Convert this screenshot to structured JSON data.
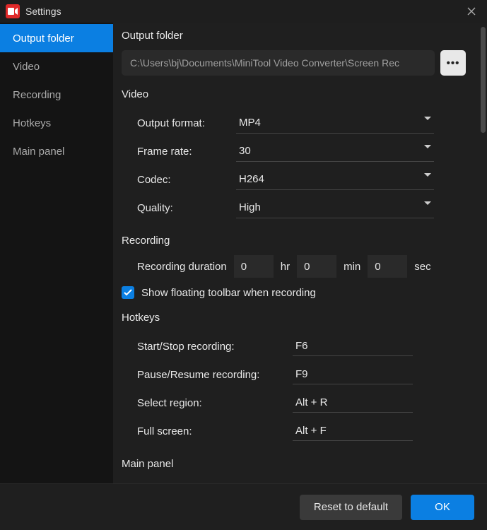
{
  "window": {
    "title": "Settings",
    "icon_name": "camera-icon"
  },
  "sidebar": {
    "items": [
      {
        "label": "Output folder",
        "active": true
      },
      {
        "label": "Video",
        "active": false
      },
      {
        "label": "Recording",
        "active": false
      },
      {
        "label": "Hotkeys",
        "active": false
      },
      {
        "label": "Main panel",
        "active": false
      }
    ]
  },
  "sections": {
    "output_folder": {
      "title": "Output folder",
      "path": "C:\\Users\\bj\\Documents\\MiniTool Video Converter\\Screen Rec",
      "browse_label": "•••"
    },
    "video": {
      "title": "Video",
      "rows": {
        "output_format": {
          "label": "Output format:",
          "value": "MP4"
        },
        "frame_rate": {
          "label": "Frame rate:",
          "value": "30"
        },
        "codec": {
          "label": "Codec:",
          "value": "H264"
        },
        "quality": {
          "label": "Quality:",
          "value": "High"
        }
      }
    },
    "recording": {
      "title": "Recording",
      "duration_label": "Recording duration",
      "hr": "0",
      "hr_unit": "hr",
      "min": "0",
      "min_unit": "min",
      "sec": "0",
      "sec_unit": "sec",
      "floating_toolbar_checked": true,
      "floating_toolbar_label": "Show floating toolbar when recording"
    },
    "hotkeys": {
      "title": "Hotkeys",
      "rows": {
        "start_stop": {
          "label": "Start/Stop recording:",
          "value": "F6"
        },
        "pause_resume": {
          "label": "Pause/Resume recording:",
          "value": "F9"
        },
        "select_region": {
          "label": "Select region:",
          "value": "Alt + R"
        },
        "full_screen": {
          "label": "Full screen:",
          "value": "Alt + F"
        }
      }
    },
    "main_panel": {
      "title": "Main panel"
    }
  },
  "footer": {
    "reset": "Reset to default",
    "ok": "OK"
  },
  "colors": {
    "accent": "#0b7fe2",
    "logo_bg": "#e02a2a"
  }
}
